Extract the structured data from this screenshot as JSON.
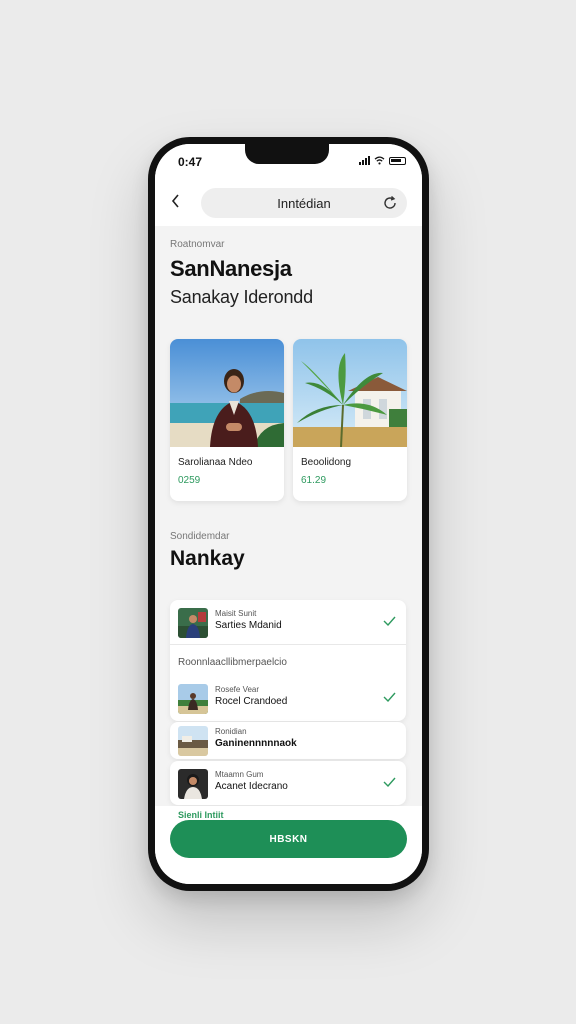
{
  "status_bar": {
    "time": "0:47",
    "icons": [
      "signal-icon",
      "wifi-icon",
      "battery-icon"
    ]
  },
  "navbar": {
    "back_icon": "chevron-left-icon",
    "url": "Inntédian",
    "refresh_icon": "refresh-icon"
  },
  "hero": {
    "eyebrow": "Roatnomvar",
    "title": "SanNanesja",
    "subtitle": "Sanakay Iderondd"
  },
  "cards": [
    {
      "title": "Sarolianaa Ndeo",
      "price": "0259",
      "image": "beach-portrait"
    },
    {
      "title": "Beoolidong",
      "price": "61.29",
      "image": "palm-house"
    }
  ],
  "section": {
    "eyebrow": "Sondidemdar",
    "title": "Nankay"
  },
  "list": {
    "rows": [
      {
        "small": "Maisit Sunit",
        "main": "Sarties Mdanid",
        "checked": true
      },
      {
        "small": "Rosefe Vear",
        "main": "Rocel Crandoed",
        "checked": true
      },
      {
        "small": "Ronidian",
        "main": "Ganinennnnnaok",
        "checked": false
      },
      {
        "small": "Mtaamn Gum",
        "main": "Acanet Idecrano",
        "checked": true
      }
    ],
    "group_label": "Roonnlaacllibmerpaelcio"
  },
  "bottom": {
    "link": "Sienli Intiit",
    "button": "HBSKN"
  },
  "colors": {
    "accent": "#1e8f57",
    "price": "#2e9a5f",
    "check": "#2e9a5f"
  }
}
